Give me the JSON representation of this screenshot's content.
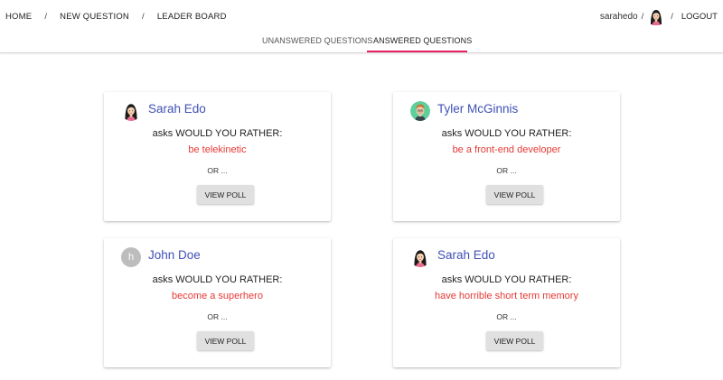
{
  "nav": {
    "home": "HOME",
    "new_question": "NEW QUESTION",
    "leader_board": "LEADER BOARD",
    "separator": "/",
    "username": "sarahedo",
    "logout": "LOGOUT"
  },
  "tabs": {
    "unanswered": "UNANSWERED QUESTIONS",
    "answered": "ANSWERED QUESTIONS",
    "active": "answered"
  },
  "colors": {
    "accent": "#e91e63",
    "author": "#3f51b5",
    "option": "#e53935"
  },
  "cards": [
    {
      "author": "Sarah Edo",
      "avatar": "sarah-avatar-icon",
      "asks": "asks WOULD YOU RATHER:",
      "option": "be telekinetic",
      "or": "OR ...",
      "button": "VIEW POLL"
    },
    {
      "author": "Tyler McGinnis",
      "avatar": "tyler-avatar-icon",
      "asks": "asks WOULD YOU RATHER:",
      "option": "be a front-end developer",
      "or": "OR ...",
      "button": "VIEW POLL"
    },
    {
      "author": "John Doe",
      "avatar": "letter-avatar",
      "avatar_letter": "h",
      "asks": "asks WOULD YOU RATHER:",
      "option": "become a superhero",
      "or": "OR ...",
      "button": "VIEW POLL"
    },
    {
      "author": "Sarah Edo",
      "avatar": "sarah-avatar-icon",
      "asks": "asks WOULD YOU RATHER:",
      "option": "have horrible short term memory",
      "or": "OR ...",
      "button": "VIEW POLL"
    }
  ]
}
